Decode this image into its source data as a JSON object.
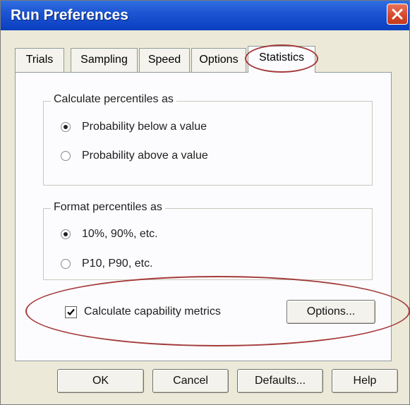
{
  "window": {
    "title": "Run Preferences"
  },
  "tabs": [
    {
      "label": "Trials",
      "active": false
    },
    {
      "label": "Sampling",
      "active": false
    },
    {
      "label": "Speed",
      "active": false
    },
    {
      "label": "Options",
      "active": false
    },
    {
      "label": "Statistics",
      "active": true
    }
  ],
  "percentiles": {
    "label": "Calculate percentiles as",
    "options": [
      {
        "label": "Probability below a value",
        "selected": true
      },
      {
        "label": "Probability above a value",
        "selected": false
      }
    ]
  },
  "format": {
    "label": "Format percentiles as",
    "options": [
      {
        "label": "10%, 90%, etc.",
        "selected": true
      },
      {
        "label": "P10, P90, etc.",
        "selected": false
      }
    ]
  },
  "capability": {
    "checkbox_label": "Calculate capability metrics",
    "checked": true,
    "options_button": "Options..."
  },
  "buttons": {
    "ok": "OK",
    "cancel": "Cancel",
    "defaults": "Defaults...",
    "help": "Help"
  },
  "colors": {
    "titlebar": "#1d55d3",
    "highlight_ring": "#a43a3a",
    "dialog_bg": "#ece9d8"
  }
}
